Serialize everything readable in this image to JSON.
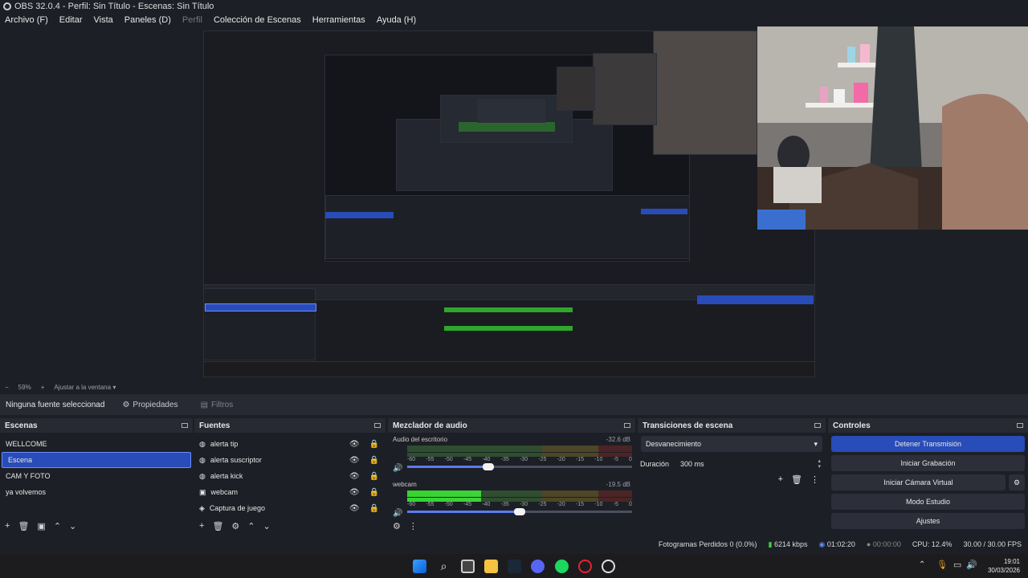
{
  "window": {
    "title": "OBS 32.0.4 - Perfil: Sin Título - Escenas: Sin Título"
  },
  "menu": {
    "items": [
      "Archivo (F)",
      "Editar",
      "Vista",
      "Paneles (D)",
      "Perfil",
      "Colección de Escenas",
      "Herramientas",
      "Ayuda (H)"
    ]
  },
  "zoom": {
    "minus": "−",
    "value": "59%",
    "plus": "+",
    "fit_label": "Ajustar a la ventana"
  },
  "context": {
    "no_source": "Ninguna fuente seleccionad",
    "properties": "Propiedades",
    "filters": "Filtros"
  },
  "scenes": {
    "title": "Escenas",
    "items": [
      "WELLCOME",
      "Escena",
      "CAM Y FOTO",
      "ya volvemos"
    ],
    "selected_index": 1
  },
  "sources": {
    "title": "Fuentes",
    "items": [
      "alerta tip",
      "alerta suscriptor",
      "alerta kick",
      "webcam",
      "Captura de juego"
    ]
  },
  "mixer": {
    "title": "Mezclador de audio",
    "channels": [
      {
        "name": "Audio del escritorio",
        "db": "-32.6 dB",
        "level": 0.0,
        "volume": 0.36
      },
      {
        "name": "webcam",
        "db": "-19.5 dB",
        "level": 0.33,
        "volume": 0.5
      }
    ],
    "ticks": [
      "-60",
      "-55",
      "-50",
      "-45",
      "-40",
      "-35",
      "-30",
      "-25",
      "-20",
      "-15",
      "-10",
      "-5",
      "0"
    ]
  },
  "transitions": {
    "title": "Transiciones de escena",
    "selected": "Desvanecimiento",
    "duration_label": "Duración",
    "duration_value": "300 ms"
  },
  "controls": {
    "title": "Controles",
    "stop_stream": "Detener Transmisión",
    "start_recording": "Iniciar Grabación",
    "start_virtualcam": "Iniciar Cámara Virtual",
    "studio_mode": "Modo Estudio",
    "settings": "Ajustes"
  },
  "status": {
    "dropped_frames": "Fotogramas Perdidos 0 (0.0%)",
    "bitrate": "6214 kbps",
    "stream_time": "01:02:20",
    "record_time": "00:00:00",
    "cpu": "CPU: 12.4%",
    "fps": "30.00 / 30.00 FPS"
  },
  "clock": {
    "time": "19:01",
    "date": "30/03/2026"
  },
  "colors": {
    "accent": "#284cb8",
    "meter_green": "#35d52f",
    "background": "#1d1f26"
  }
}
